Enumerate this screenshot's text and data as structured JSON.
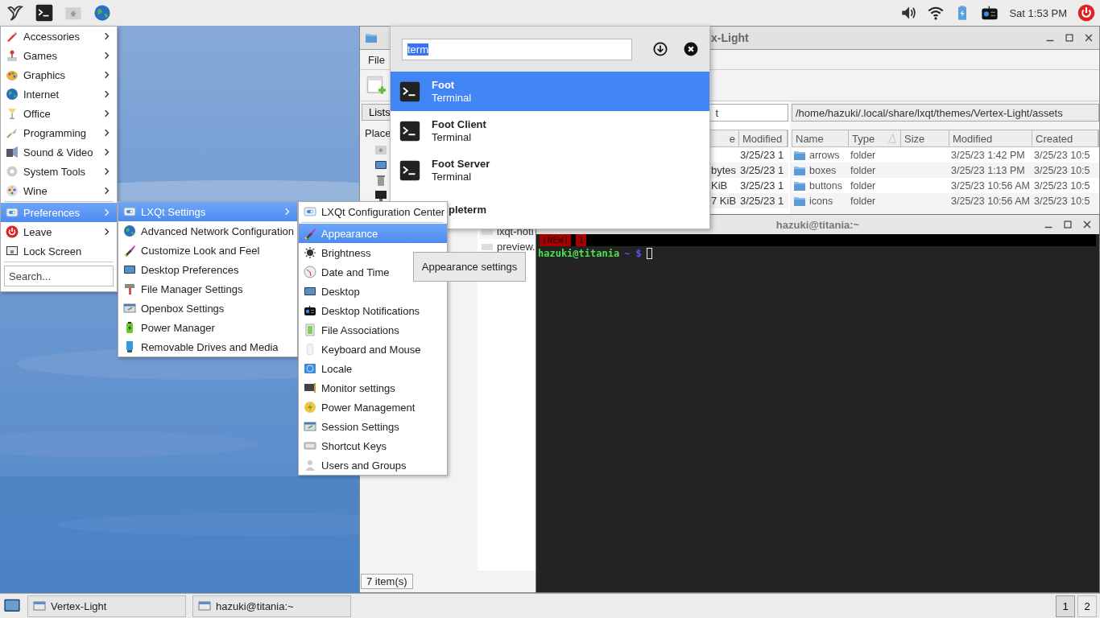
{
  "top_panel": {
    "clock": "Sat 1:53 PM"
  },
  "main_menu": {
    "items": [
      {
        "kind": "item",
        "label": "Accessories",
        "submenu": true,
        "selected": false
      },
      {
        "kind": "item",
        "label": "Games",
        "submenu": true,
        "selected": false
      },
      {
        "kind": "item",
        "label": "Graphics",
        "submenu": true,
        "selected": false
      },
      {
        "kind": "item",
        "label": "Internet",
        "submenu": true,
        "selected": false
      },
      {
        "kind": "item",
        "label": "Office",
        "submenu": true,
        "selected": false
      },
      {
        "kind": "item",
        "label": "Programming",
        "submenu": true,
        "selected": false
      },
      {
        "kind": "item",
        "label": "Sound & Video",
        "submenu": true,
        "selected": false
      },
      {
        "kind": "item",
        "label": "System Tools",
        "submenu": true,
        "selected": false
      },
      {
        "kind": "item",
        "label": "Wine",
        "submenu": true,
        "selected": false
      },
      {
        "kind": "separator"
      },
      {
        "kind": "item",
        "label": "Preferences",
        "submenu": true,
        "selected": true
      },
      {
        "kind": "item",
        "label": "Leave",
        "submenu": true,
        "selected": false
      },
      {
        "kind": "item",
        "label": "Lock Screen",
        "submenu": false,
        "selected": false
      },
      {
        "kind": "separator"
      }
    ],
    "search": {
      "placeholder": "Search..."
    }
  },
  "lxqt_menu": {
    "items": [
      {
        "kind": "item",
        "label": "LXQt Settings",
        "submenu": true,
        "selected": true
      },
      {
        "kind": "item",
        "label": "Advanced Network Configuration",
        "submenu": false,
        "selected": false
      },
      {
        "kind": "item",
        "label": "Customize Look and Feel",
        "submenu": false,
        "selected": false
      },
      {
        "kind": "item",
        "label": "Desktop Preferences",
        "submenu": false,
        "selected": false
      },
      {
        "kind": "item",
        "label": "File Manager Settings",
        "submenu": false,
        "selected": false
      },
      {
        "kind": "item",
        "label": "Openbox Settings",
        "submenu": false,
        "selected": false
      },
      {
        "kind": "item",
        "label": "Power Manager",
        "submenu": false,
        "selected": false
      },
      {
        "kind": "item",
        "label": "Removable Drives and Media",
        "submenu": false,
        "selected": false
      }
    ]
  },
  "settings_menu": {
    "items": [
      {
        "kind": "item",
        "label": "LXQt Configuration Center",
        "selected": false
      },
      {
        "kind": "separator"
      },
      {
        "kind": "item",
        "label": "Appearance",
        "selected": true
      },
      {
        "kind": "item",
        "label": "Brightness",
        "selected": false
      },
      {
        "kind": "item",
        "label": "Date and Time",
        "selected": false
      },
      {
        "kind": "item",
        "label": "Desktop",
        "selected": false
      },
      {
        "kind": "item",
        "label": "Desktop Notifications",
        "selected": false
      },
      {
        "kind": "item",
        "label": "File Associations",
        "selected": false
      },
      {
        "kind": "item",
        "label": "Keyboard and Mouse",
        "selected": false
      },
      {
        "kind": "item",
        "label": "Locale",
        "selected": false
      },
      {
        "kind": "item",
        "label": "Monitor settings",
        "selected": false
      },
      {
        "kind": "item",
        "label": "Power Management",
        "selected": false
      },
      {
        "kind": "item",
        "label": "Session Settings",
        "selected": false
      },
      {
        "kind": "item",
        "label": "Shortcut Keys",
        "selected": false
      },
      {
        "kind": "item",
        "label": "Users and Groups",
        "selected": false
      }
    ]
  },
  "tooltip": "Appearance settings",
  "runner": {
    "query": "term",
    "results": [
      {
        "name": "Foot",
        "desc": "Terminal",
        "selected": true
      },
      {
        "name": "Foot Client",
        "desc": "Terminal",
        "selected": false
      },
      {
        "name": "Foot Server",
        "desc": "Terminal",
        "selected": false
      },
      {
        "name": "pleterm",
        "selected": false
      }
    ]
  },
  "file_manager": {
    "title": "x-Light",
    "menu": [
      "File"
    ],
    "side_tab": "Lists",
    "places_label": "Place",
    "left_pane": {
      "filter": "t",
      "columns": [
        "e",
        "Modified"
      ],
      "rows": [
        {
          "modified": "3/25/23 1"
        },
        {
          "size": "bytes",
          "modified": "3/25/23 1"
        },
        {
          "size": "KiB",
          "modified": "3/25/23 1"
        },
        {
          "size": "7 KiB",
          "modified": "3/25/23 1"
        },
        {},
        {
          "name": "lxqt-noti"
        },
        {
          "name": "preview."
        }
      ]
    },
    "right_pane": {
      "path": "/home/hazuki/.local/share/lxqt/themes/Vertex-Light/assets",
      "columns": [
        "Name",
        "Type",
        "Size",
        "Modified",
        "Created"
      ],
      "rows": [
        {
          "name": "arrows",
          "type": "folder",
          "modified": "3/25/23 1:42 PM",
          "created": "3/25/23 10:5"
        },
        {
          "name": "boxes",
          "type": "folder",
          "modified": "3/25/23 1:13 PM",
          "created": "3/25/23 10:5"
        },
        {
          "name": "buttons",
          "type": "folder",
          "modified": "3/25/23 10:56 AM",
          "created": "3/25/23 10:5"
        },
        {
          "name": "icons",
          "type": "folder",
          "modified": "3/25/23 10:56 AM",
          "created": "3/25/23 10:5"
        }
      ]
    },
    "status": "7 item(s)"
  },
  "terminal": {
    "title": "hazuki@titania:~",
    "tmux_tabs": [
      "[NEW]",
      "1"
    ],
    "prompt_user": "hazuki@titania",
    "prompt_path": "~ $"
  },
  "taskbar": {
    "tasks": [
      "Vertex-Light",
      "hazuki@titania:~"
    ],
    "desktops": [
      {
        "label": "1",
        "selected": true
      },
      {
        "label": "2",
        "selected": false
      }
    ]
  }
}
